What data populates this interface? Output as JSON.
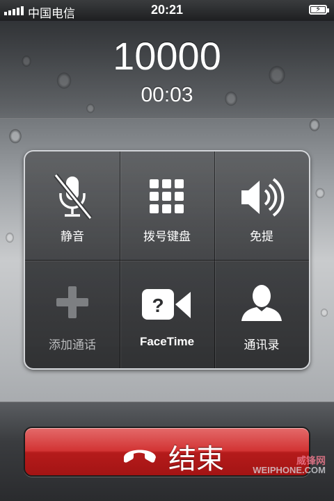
{
  "status_bar": {
    "carrier": "中国电信",
    "time": "20:21",
    "battery_level": 1.0
  },
  "call": {
    "number": "10000",
    "duration": "00:03"
  },
  "keypad": {
    "mute_label": "静音",
    "dialpad_label": "拨号键盘",
    "speaker_label": "免提",
    "add_call_label": "添加通话",
    "facetime_label": "FaceTime",
    "contacts_label": "通讯录"
  },
  "end_call": {
    "label": "结束",
    "color": "#c62828"
  },
  "watermark": {
    "line1": "威锋网",
    "line2": "WEIPHONE.COM"
  }
}
